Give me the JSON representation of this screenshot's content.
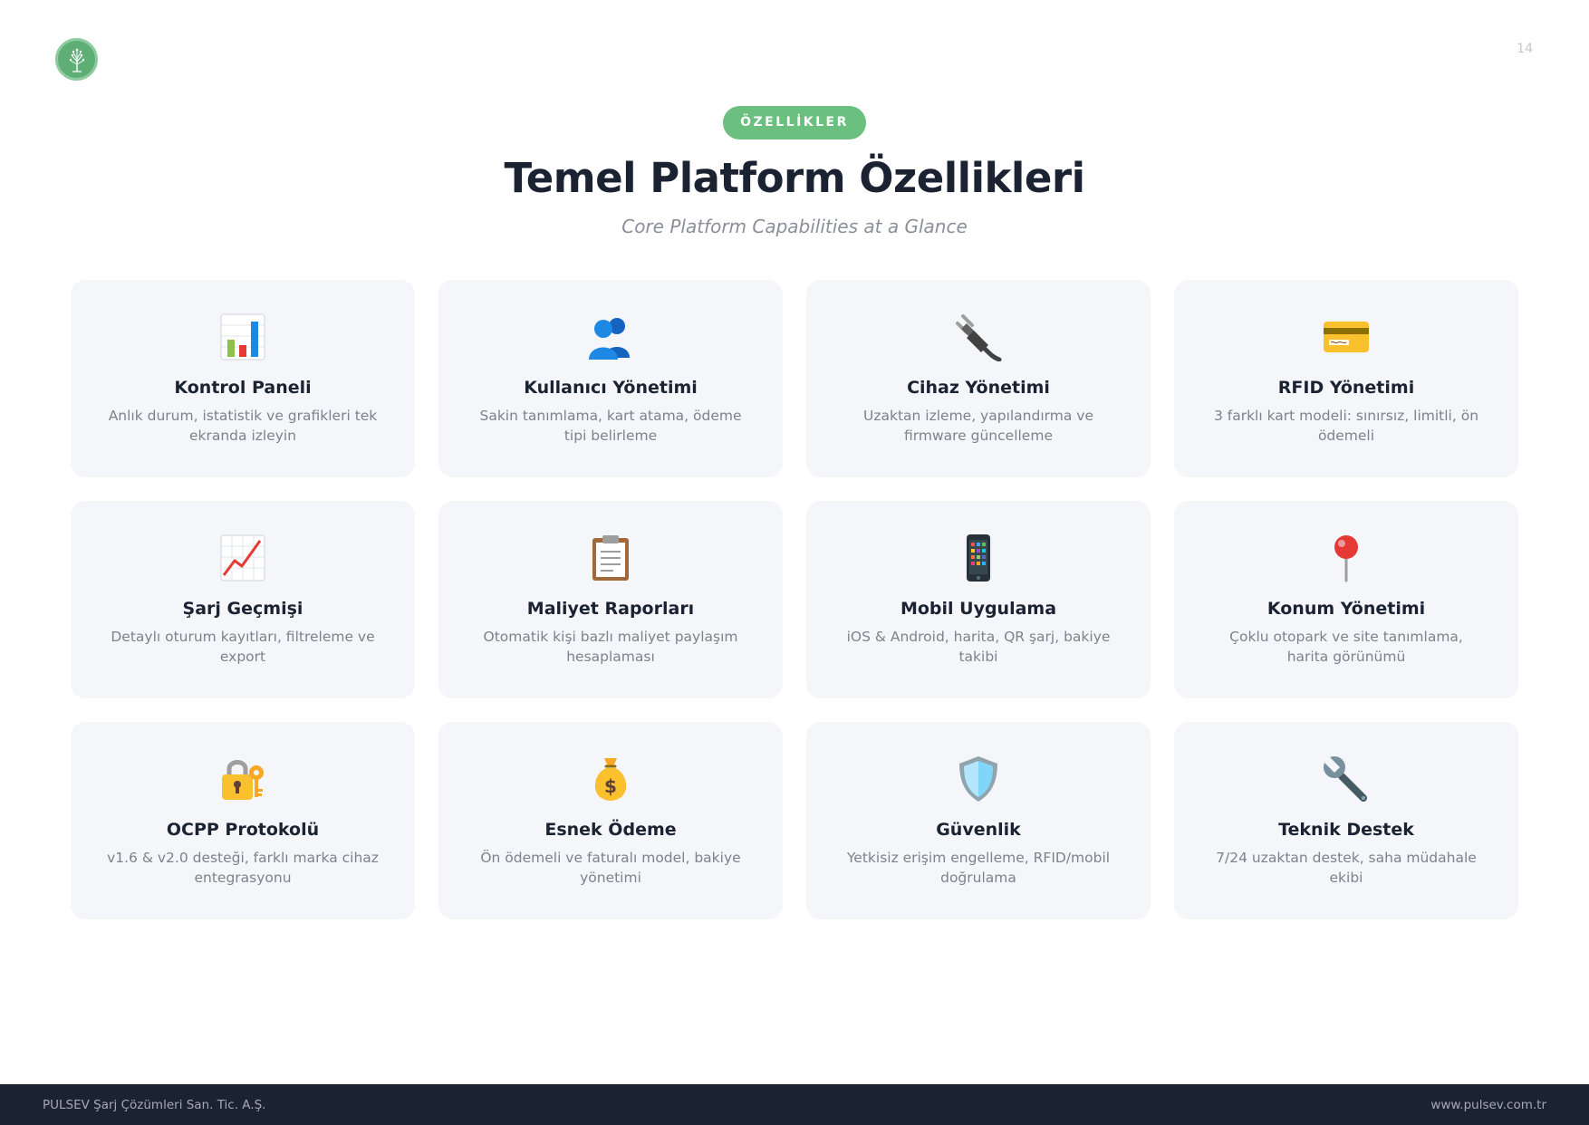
{
  "page_number": "14",
  "header": {
    "badge": "ÖZELLİKLER",
    "title": "Temel Platform Özellikleri",
    "subtitle": "Core Platform Capabilities at a Glance"
  },
  "cards": [
    {
      "icon": "bar-chart-icon",
      "title": "Kontrol Paneli",
      "desc": "Anlık durum, istatistik ve grafikleri tek ekranda izleyin"
    },
    {
      "icon": "users-icon",
      "title": "Kullanıcı Yönetimi",
      "desc": "Sakin tanımlama, kart atama, ödeme tipi belirleme"
    },
    {
      "icon": "plug-icon",
      "title": "Cihaz Yönetimi",
      "desc": "Uzaktan izleme, yapılandırma ve firmware güncelleme"
    },
    {
      "icon": "credit-card-icon",
      "title": "RFID Yönetimi",
      "desc": "3 farklı kart modeli: sınırsız, limitli, ön ödemeli"
    },
    {
      "icon": "trend-chart-icon",
      "title": "Şarj Geçmişi",
      "desc": "Detaylı oturum kayıtları, filtreleme ve export"
    },
    {
      "icon": "clipboard-icon",
      "title": "Maliyet Raporları",
      "desc": "Otomatik kişi bazlı maliyet paylaşım hesaplaması"
    },
    {
      "icon": "mobile-phone-icon",
      "title": "Mobil Uygulama",
      "desc": "iOS & Android, harita, QR şarj, bakiye takibi"
    },
    {
      "icon": "location-pin-icon",
      "title": "Konum Yönetimi",
      "desc": "Çoklu otopark ve site tanımlama, harita görünümü"
    },
    {
      "icon": "lock-key-icon",
      "title": "OCPP Protokolü",
      "desc": "v1.6 & v2.0 desteği, farklı marka cihaz entegrasyonu"
    },
    {
      "icon": "money-bag-icon",
      "title": "Esnek Ödeme",
      "desc": "Ön ödemeli ve faturalı model, bakiye yönetimi"
    },
    {
      "icon": "shield-icon",
      "title": "Güvenlik",
      "desc": "Yetkisiz erişim engelleme, RFID/mobil doğrulama"
    },
    {
      "icon": "wrench-icon",
      "title": "Teknik Destek",
      "desc": "7/24 uzaktan destek, saha müdahale ekibi"
    }
  ],
  "footer": {
    "company": "PULSEV Şarj Çözümleri San. Tic. A.Ş.",
    "website": "www.pulsev.com.tr"
  },
  "colors": {
    "accent": "#6cc07f",
    "dark": "#1b2333",
    "card_bg": "#f5f6f9"
  }
}
